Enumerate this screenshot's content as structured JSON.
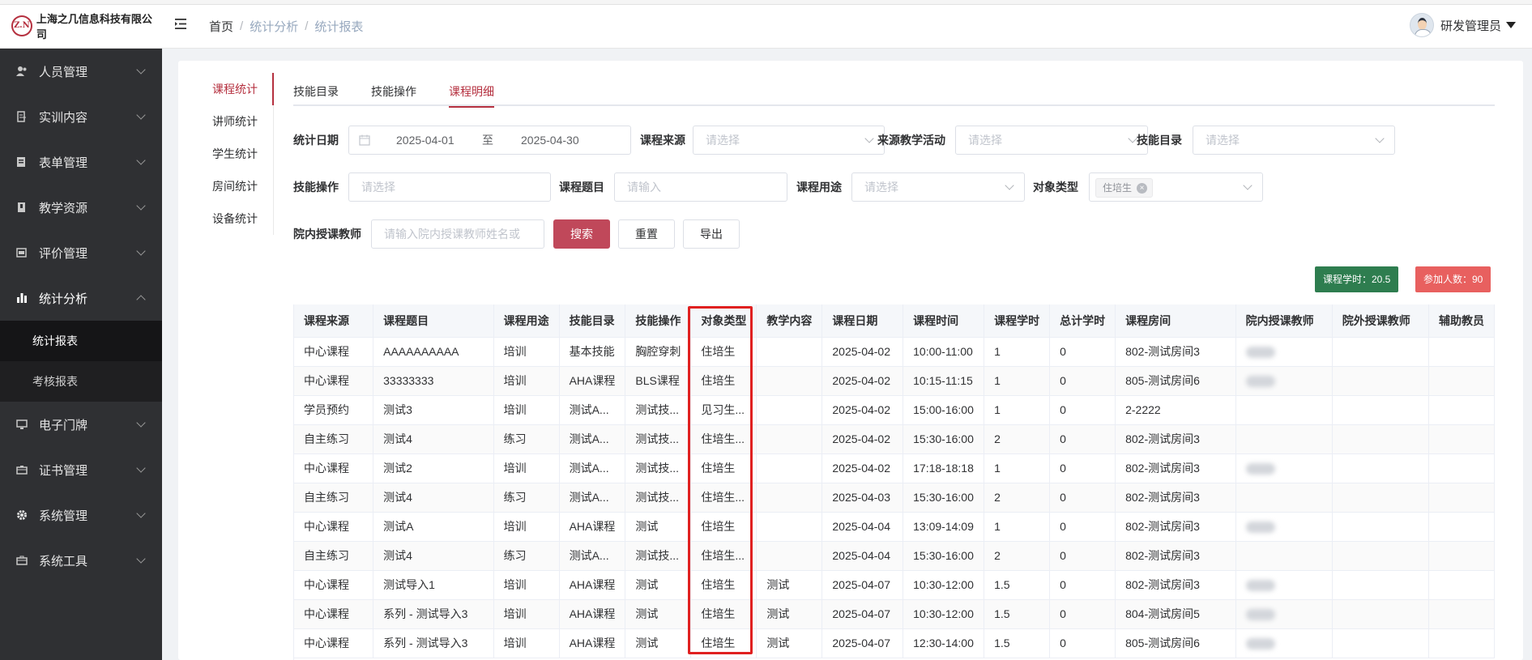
{
  "brand": {
    "logo_text": "Z.N",
    "name": "上海之几信息科技有限公司"
  },
  "breadcrumb": [
    "首页",
    "统计分析",
    "统计报表"
  ],
  "user": {
    "name": "研发管理员"
  },
  "sidebar": {
    "items": [
      {
        "label": "人员管理",
        "icon": "people-icon"
      },
      {
        "label": "实训内容",
        "icon": "training-icon"
      },
      {
        "label": "表单管理",
        "icon": "form-icon"
      },
      {
        "label": "教学资源",
        "icon": "book-icon"
      },
      {
        "label": "评价管理",
        "icon": "evaluate-icon"
      },
      {
        "label": "统计分析",
        "icon": "bar-chart-icon"
      },
      {
        "label": "电子门牌",
        "icon": "monitor-icon"
      },
      {
        "label": "证书管理",
        "icon": "certificate-icon"
      },
      {
        "label": "系统管理",
        "icon": "gear-icon"
      },
      {
        "label": "系统工具",
        "icon": "toolbox-icon"
      }
    ],
    "subitems": [
      "统计报表",
      "考核报表"
    ]
  },
  "stat_nav": [
    "课程统计",
    "讲师统计",
    "学生统计",
    "房间统计",
    "设备统计"
  ],
  "tabs": [
    "技能目录",
    "技能操作",
    "课程明细"
  ],
  "form": {
    "date_label": "统计日期",
    "date_start": "2025-04-01",
    "date_sep": "至",
    "date_end": "2025-04-30",
    "source_label": "课程来源",
    "source_placeholder": "请选择",
    "activity_label": "来源教学活动",
    "activity_placeholder": "请选择",
    "skill_dir_label": "技能目录",
    "skill_dir_placeholder": "请选择",
    "skill_op_label": "技能操作",
    "skill_op_placeholder": "请选择",
    "topic_label": "课程题目",
    "topic_placeholder": "请输入",
    "purpose_label": "课程用途",
    "purpose_placeholder": "请选择",
    "target_label": "对象类型",
    "target_tag": "住培生",
    "teacher_label": "院内授课教师",
    "teacher_placeholder": "请输入院内授课教师姓名或",
    "search_btn": "搜索",
    "reset_btn": "重置",
    "export_btn": "导出"
  },
  "summary": {
    "hours": "课程学时：20.5",
    "people": "参加人数：90",
    "hours_color": "#2e7d4f",
    "people_color": "#e8605f"
  },
  "table": {
    "columns": [
      "课程来源",
      "课程题目",
      "课程用途",
      "技能目录",
      "技能操作",
      "对象类型",
      "教学内容",
      "课程日期",
      "课程时间",
      "课程学时",
      "总计学时",
      "课程房间",
      "院内授课教师",
      "院外授课教师",
      "辅助教员"
    ],
    "rows": [
      [
        "中心课程",
        "AAAAAAAAAA",
        "培训",
        "基本技能",
        "胸腔穿刺",
        "住培生",
        "",
        "2025-04-02",
        "10:00-11:00",
        "1",
        "0",
        "802-测试房间3",
        "",
        "",
        ""
      ],
      [
        "中心课程",
        "33333333",
        "培训",
        "AHA课程",
        "BLS课程",
        "住培生",
        "",
        "2025-04-02",
        "10:15-11:15",
        "1",
        "0",
        "805-测试房间6",
        "",
        "",
        ""
      ],
      [
        "学员预约",
        "测试3",
        "培训",
        "测试A...",
        "测试技...",
        "见习生...",
        "",
        "2025-04-02",
        "15:00-16:00",
        "1",
        "0",
        "2-2222",
        "",
        "",
        ""
      ],
      [
        "自主练习",
        "测试4",
        "练习",
        "测试A...",
        "测试技...",
        "住培生...",
        "",
        "2025-04-02",
        "15:30-16:00",
        "2",
        "0",
        "802-测试房间3",
        "",
        "",
        ""
      ],
      [
        "中心课程",
        "测试2",
        "培训",
        "测试A...",
        "测试技...",
        "住培生",
        "",
        "2025-04-02",
        "17:18-18:18",
        "1",
        "0",
        "802-测试房间3",
        "",
        "",
        ""
      ],
      [
        "自主练习",
        "测试4",
        "练习",
        "测试A...",
        "测试技...",
        "住培生...",
        "",
        "2025-04-03",
        "15:30-16:00",
        "2",
        "0",
        "802-测试房间3",
        "",
        "",
        ""
      ],
      [
        "中心课程",
        "测试A",
        "培训",
        "AHA课程",
        "测试",
        "住培生",
        "",
        "2025-04-04",
        "13:09-14:09",
        "1",
        "0",
        "802-测试房间3",
        "",
        "",
        ""
      ],
      [
        "自主练习",
        "测试4",
        "练习",
        "测试A...",
        "测试技...",
        "住培生...",
        "",
        "2025-04-04",
        "15:30-16:00",
        "2",
        "0",
        "802-测试房间3",
        "",
        "",
        ""
      ],
      [
        "中心课程",
        "测试导入1",
        "培训",
        "AHA课程",
        "测试",
        "住培生",
        "测试",
        "2025-04-07",
        "10:30-12:00",
        "1.5",
        "0",
        "802-测试房间3",
        "",
        "",
        ""
      ],
      [
        "中心课程",
        "系列 - 测试导入3",
        "培训",
        "AHA课程",
        "测试",
        "住培生",
        "测试",
        "2025-04-07",
        "10:30-12:00",
        "1.5",
        "0",
        "804-测试房间5",
        "",
        "",
        ""
      ],
      [
        "中心课程",
        "系列 - 测试导入3",
        "培训",
        "AHA课程",
        "测试",
        "住培生",
        "测试",
        "2025-04-07",
        "12:30-14:00",
        "1.5",
        "0",
        "805-测试房间6",
        "",
        "",
        ""
      ]
    ],
    "blurred_teacher_rows": [
      0,
      1,
      4,
      6,
      8,
      9,
      10
    ]
  }
}
